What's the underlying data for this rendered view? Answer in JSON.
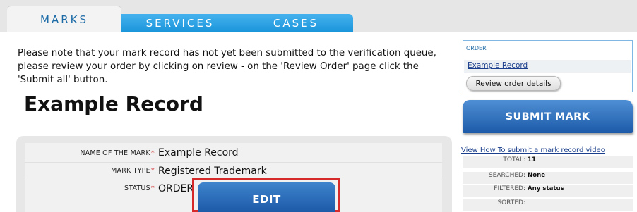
{
  "tabs": [
    {
      "label": "MARKS",
      "active": true
    },
    {
      "label": "SERVICES",
      "active": false
    },
    {
      "label": "CASES",
      "active": false
    }
  ],
  "notice": "Please note that your mark record has not yet been submitted to the verification queue, please review your order by clicking on review - on the 'Review Order' page click the 'Submit all' button.",
  "page_title": "Example Record",
  "record": {
    "fields": [
      {
        "label": "NAME OF THE MARK",
        "required_marker": "*",
        "value": "Example Record"
      },
      {
        "label": "MARK TYPE",
        "required_marker": "*",
        "value": "Registered Trademark"
      },
      {
        "label": "STATUS",
        "required_marker": "*",
        "value": "ORDER"
      }
    ],
    "edit_label": "EDIT"
  },
  "sidebar": {
    "order_heading": "ORDER",
    "order_item": "Example Record",
    "review_button": "Review order details",
    "submit_button": "SUBMIT MARK",
    "video_link": "View How To submit a mark record video",
    "stats": [
      {
        "key": "TOTAL:",
        "value": "11"
      },
      {
        "key": "SEARCHED:",
        "value": "None"
      },
      {
        "key": "FILTERED:",
        "value": "Any status"
      },
      {
        "key": "SORTED:",
        "value": ""
      }
    ]
  },
  "colors": {
    "tab_active_text": "#1b6aa6",
    "tab_inactive_bg": "#1a94da",
    "button_blue": "#1d5aa8",
    "highlight_red": "#d62a2a",
    "required_star": "#d43232"
  }
}
